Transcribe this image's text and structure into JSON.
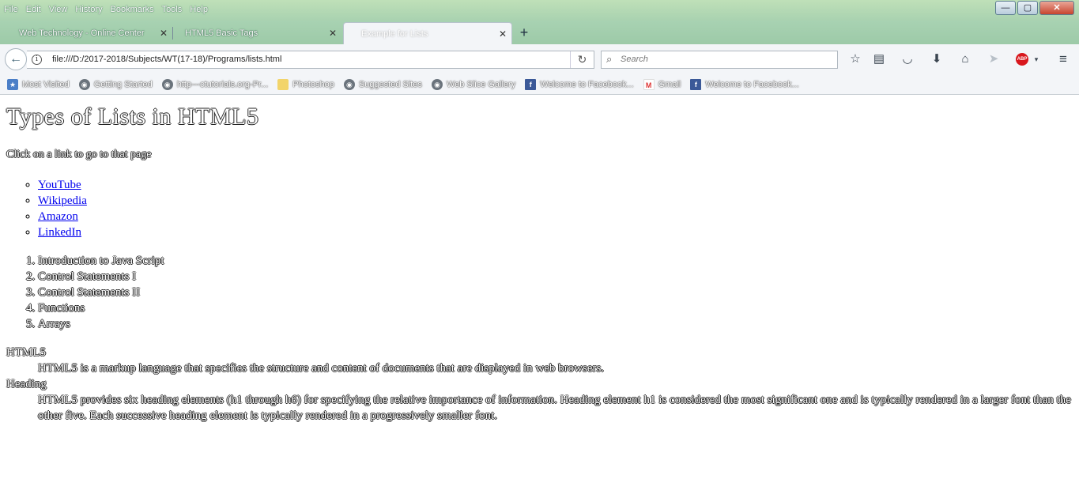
{
  "menu": [
    "File",
    "Edit",
    "View",
    "History",
    "Bookmarks",
    "Tools",
    "Help"
  ],
  "window_controls": {
    "minimize": "—",
    "maximize": "▢",
    "close": "✕"
  },
  "tabs": [
    {
      "label": "Web Technology - Online Center"
    },
    {
      "label": "HTML5 Basic Tags"
    },
    {
      "label": "Example for Lists"
    }
  ],
  "new_tab_label": "+",
  "address": {
    "url": "file:///D:/2017-2018/Subjects/WT(17-18)/Programs/lists.html"
  },
  "search": {
    "placeholder": "Search"
  },
  "bookmarks": [
    {
      "label": "Most Visited",
      "icon": "most-visited-icon"
    },
    {
      "label": "Getting Started",
      "icon": "globe-icon"
    },
    {
      "label": "http---ctutorials.org-Pr...",
      "icon": "globe-icon"
    },
    {
      "label": "Photoshop",
      "icon": "folder-icon"
    },
    {
      "label": "Suggested Sites",
      "icon": "globe-icon"
    },
    {
      "label": "Web Slice Gallery",
      "icon": "globe-icon"
    },
    {
      "label": "Welcome to Facebook...",
      "icon": "facebook-icon"
    },
    {
      "label": "Gmail",
      "icon": "gmail-icon"
    },
    {
      "label": "Welcome to Facebook...",
      "icon": "facebook-icon"
    }
  ],
  "page": {
    "title": "Types of Lists in HTML5",
    "instruction": "Click on a link to go to that page",
    "links": [
      "YouTube",
      "Wikipedia",
      "Amazon",
      "LinkedIn"
    ],
    "topics": [
      "Introduction to Java Script",
      "Control Statements I",
      "Control Statements II",
      "Functions",
      "Arrays"
    ],
    "definitions": [
      {
        "term": "HTML5",
        "description": "HTML5 is a markup language that specifies the structure and content of documents that are displayed in web browsers."
      },
      {
        "term": "Heading",
        "description": "HTML5 provides six heading elements (h1 through h6) for specifying the relative importance of information. Heading element h1 is considered the most significant one and is typically rendered in a larger font than the other five. Each successive heading element is typically rendered in a progressively smaller font."
      }
    ]
  },
  "colors": {
    "link": "#0000ee",
    "chrome": "#f3f5f8",
    "titlebar": "#a9d2b0"
  }
}
